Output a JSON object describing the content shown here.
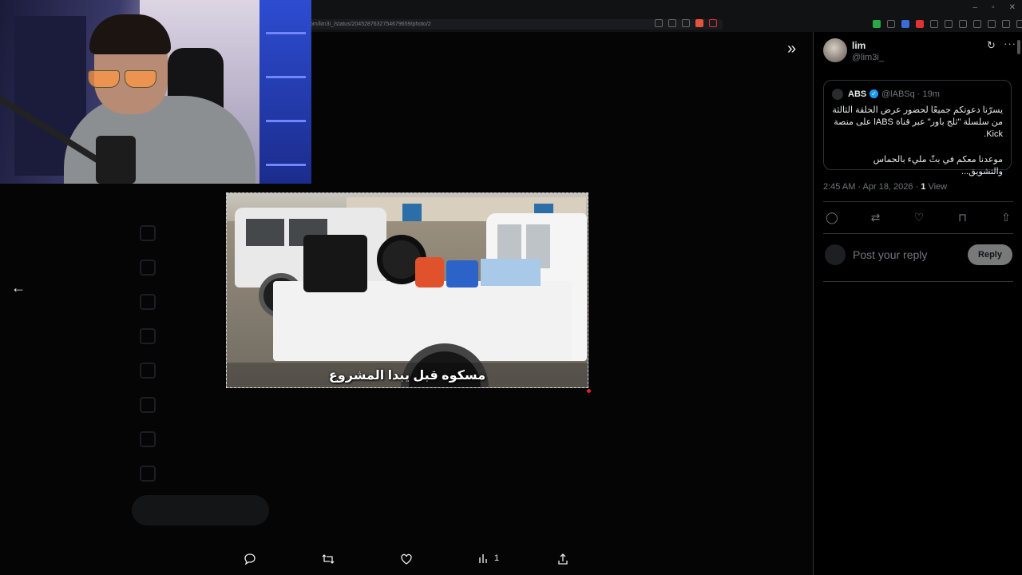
{
  "browser": {
    "url": "om/lim3i_/status/2045287632754679659/photo/2",
    "window_controls": [
      "–",
      "▫",
      "✕"
    ]
  },
  "background_page": {
    "nav_items": [
      "",
      "",
      "",
      "",
      "",
      "",
      "",
      ""
    ],
    "post_button": ""
  },
  "media": {
    "caption": "مسكوه قبل يبدا المشروع",
    "views_count": "1"
  },
  "side_panel": {
    "author_name": "lim",
    "author_handle": "@lim3i_",
    "quote": {
      "name": "ABS",
      "handle_time": "@lABSq · 19m",
      "text_line1": "يسرّنا دعوتكم جميعًا لحضور عرض الحلقة الثالثة من سلسلة \"ثلج باور\" عبر قناة lABS على منصة Kick.",
      "text_line2": "موعدنا معكم في بثّ مليء بالحماس والتشويق..."
    },
    "timestamp": "2:45 AM · Apr 18, 2026 · ",
    "views_count": "1",
    "views_label": " View",
    "reply_placeholder": "Post your reply",
    "reply_button": "Reply"
  },
  "icons": {
    "back": "arrow-left-icon",
    "collapse": "double-chevron-right-icon",
    "reply": "comment-icon",
    "repost": "repost-icon",
    "like": "heart-icon",
    "views": "bar-chart-icon",
    "share": "share-icon",
    "bookmark": "bookmark-icon",
    "grok": "grok-icon",
    "more": "more-icon"
  },
  "colors": {
    "background": "#000000",
    "text": "#e7e9ea",
    "muted": "#71767b",
    "verified": "#1d9bf0",
    "border": "#2f3336"
  }
}
